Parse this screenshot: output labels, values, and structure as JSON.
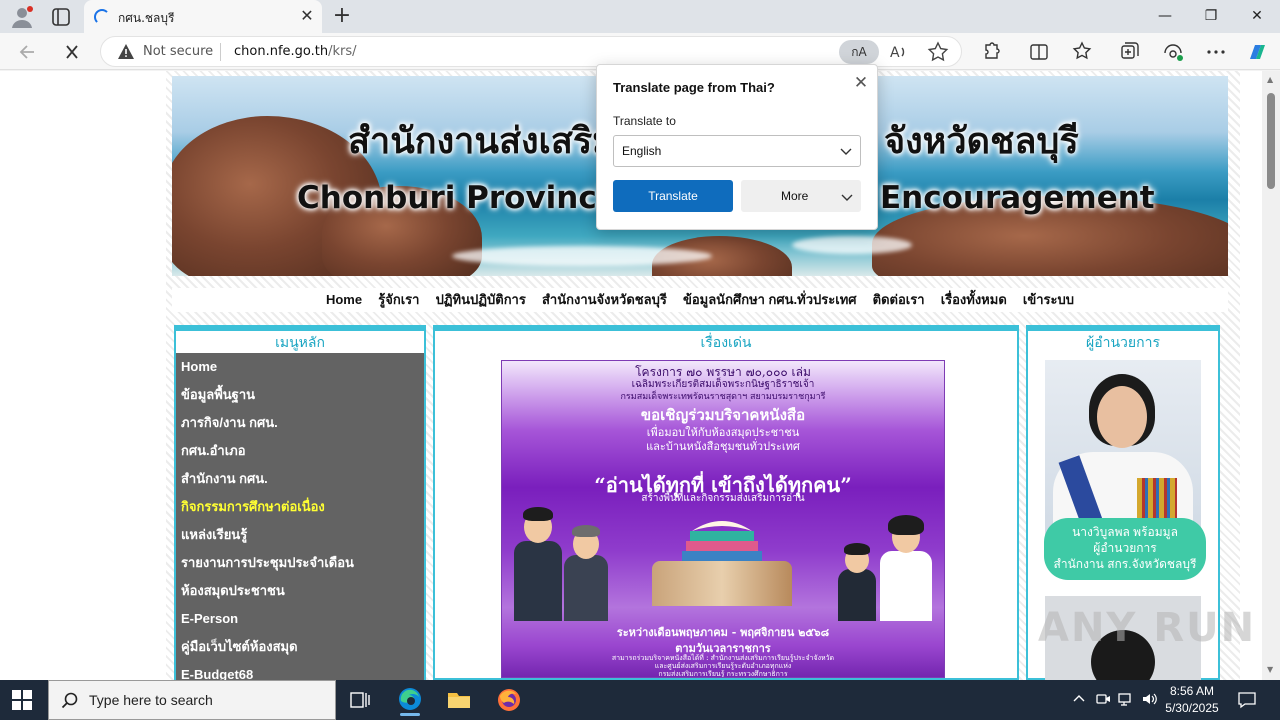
{
  "browser": {
    "tab_title": "กศน.ชลบุรี",
    "new_tab_symbol": "+",
    "close_symbol": "✕",
    "url_host": "chon.nfe.go.th",
    "url_path": "/krs/",
    "security_label": "Not secure",
    "translate_chip": "กA",
    "window_controls": {
      "minimize": "—",
      "restore": "❐",
      "close": "✕"
    }
  },
  "translate_popup": {
    "title": "Translate page from Thai?",
    "label": "Translate to",
    "selected_language": "English",
    "translate_button": "Translate",
    "more_button": "More",
    "close_symbol": "✕"
  },
  "site": {
    "banner_thai_left": "สำนักงานส่งเสริม",
    "banner_thai_right": "จังหวัดชลบุรี",
    "banner_eng_left": "Chonburi Provincial",
    "banner_eng_right": "Encouragement",
    "top_menu": [
      "Home",
      "รู้จักเรา",
      "ปฏิทินปฏิบัติการ",
      "สำนักงานจังหวัดชลบุรี",
      "ข้อมูลนักศึกษา กศน.ทั่วประเทศ",
      "ติดต่อเรา",
      "เรื่องทั้งหมด",
      "เข้าระบบ"
    ],
    "left_column": {
      "heading": "เมนูหลัก",
      "items": [
        "Home",
        "ข้อมูลพื้นฐาน",
        "ภารกิจ/งาน กศน.",
        "กศน.อำเภอ",
        "สำนักงาน กศน.",
        "กิจกรรมการศึกษาต่อเนื่อง",
        "แหล่งเรียนรู้",
        "รายงานการประชุมประจำเดือน",
        "ห้องสมุดประชาชน",
        "E-Person",
        "คู่มือเว็บไซต์ห้องสมุด",
        "E-Budget68"
      ],
      "active_index": 5
    },
    "middle_column": {
      "heading": "เรื่องเด่น",
      "poster": {
        "line1": "โครงการ ๗๐ พรรษา ๗๐,๐๐๐ เล่ม",
        "line2": "เฉลิมพระเกียรติสมเด็จพระกนิษฐาธิราชเจ้า",
        "line3": "กรมสมเด็จพระเทพรัตนราชสุดาฯ สยามบรมราชกุมารี",
        "line4": "ขอเชิญร่วมบริจาคหนังสือ",
        "line5": "เพื่อมอบให้กับห้องสมุดประชาชน",
        "line6": "และบ้านหนังสือชุมชนทั่วประเทศ",
        "line7": "“อ่านได้ทุกที่ เข้าถึงได้ทุกคน”",
        "line8": "สร้างพื้นที่และกิจกรรมส่งเสริมการอ่าน",
        "line9": "ระหว่างเดือนพฤษภาคม - พฤศจิกายน ๒๕๖๘",
        "line10": "ตามวันเวลาราชการ",
        "line11": "สามารถร่วมบริจาคหนังสือได้ที่ : สำนักงานส่งเสริมการเรียนรู้ประจำจังหวัด",
        "line12": "และศูนย์ส่งเสริมการเรียนรู้ระดับอำเภอทุกแห่ง",
        "line13": "กรมส่งเสริมการเรียนรู้ กระทรวงศึกษาธิการ"
      }
    },
    "right_column": {
      "heading": "ผู้อำนวยการ",
      "caption_line1": "นางวิบูลพล พร้อมมูล",
      "caption_line2": "ผู้อำนวยการ",
      "caption_line3": "สำนักงาน สกร.จังหวัดชลบุรี"
    },
    "watermark": "ANY RUN"
  },
  "taskbar": {
    "search_placeholder": "Type here to search",
    "time": "8:56 AM",
    "date": "5/30/2025"
  },
  "colors": {
    "accent_cyan": "#3cc0d8",
    "menu_bg": "#636363",
    "active_menu_text": "#ffff33",
    "translate_blue": "#0f6cbd"
  }
}
